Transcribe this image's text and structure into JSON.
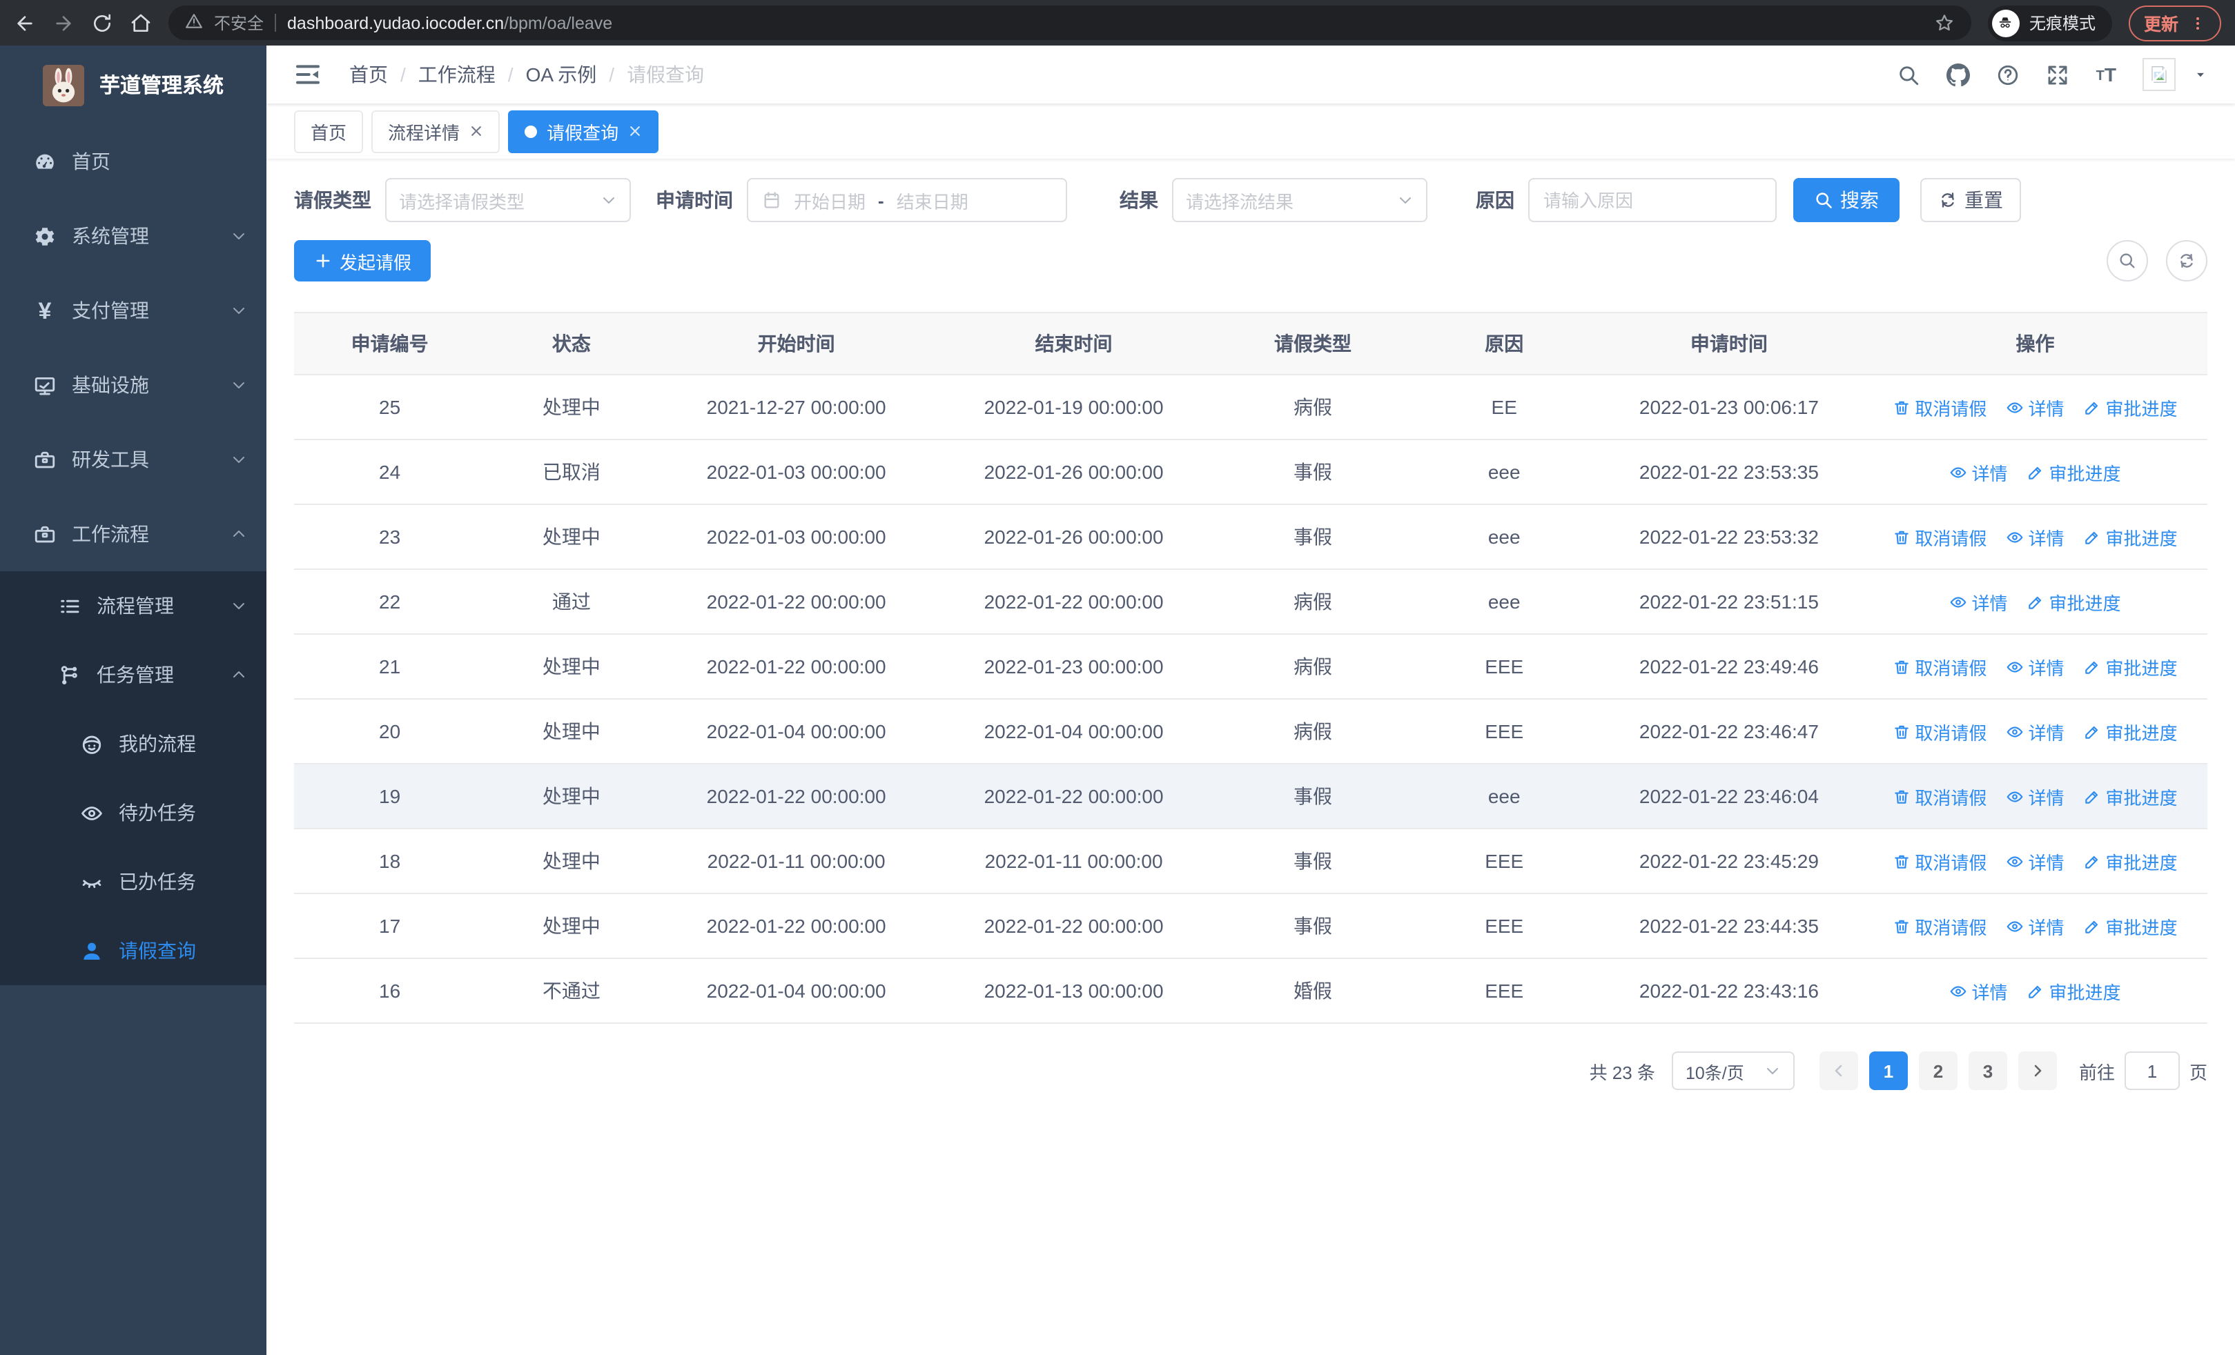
{
  "browser": {
    "security_label": "不安全",
    "url_host": "dashboard.yudao.iocoder.cn",
    "url_path": "/bpm/oa/leave",
    "incognito_label": "无痕模式",
    "update_label": "更新"
  },
  "sidebar": {
    "app_title": "芋道管理系统",
    "items": [
      {
        "name": "home",
        "label": "首页",
        "icon": "dashboard-icon",
        "level": 1,
        "submenu": false,
        "active": false,
        "chevron": null
      },
      {
        "name": "system-management",
        "label": "系统管理",
        "icon": "gear-icon",
        "level": 1,
        "submenu": false,
        "active": false,
        "chevron": "down"
      },
      {
        "name": "payment-management",
        "label": "支付管理",
        "icon": "yen-icon",
        "level": 1,
        "submenu": false,
        "active": false,
        "chevron": "down"
      },
      {
        "name": "infrastructure",
        "label": "基础设施",
        "icon": "monitor-icon",
        "level": 1,
        "submenu": false,
        "active": false,
        "chevron": "down"
      },
      {
        "name": "dev-tools",
        "label": "研发工具",
        "icon": "toolbox-icon",
        "level": 1,
        "submenu": false,
        "active": false,
        "chevron": "down"
      },
      {
        "name": "workflow",
        "label": "工作流程",
        "icon": "briefcase-icon",
        "level": 1,
        "submenu": false,
        "active": false,
        "chevron": "up"
      },
      {
        "name": "process-management",
        "label": "流程管理",
        "icon": "list-icon",
        "level": 2,
        "submenu": true,
        "active": false,
        "chevron": "down"
      },
      {
        "name": "task-management",
        "label": "任务管理",
        "icon": "flow-icon",
        "level": 2,
        "submenu": true,
        "active": false,
        "chevron": "up"
      },
      {
        "name": "my-process",
        "label": "我的流程",
        "icon": "robot-icon",
        "level": 3,
        "submenu": true,
        "active": false,
        "chevron": null
      },
      {
        "name": "todo-tasks",
        "label": "待办任务",
        "icon": "eye-icon",
        "level": 3,
        "submenu": true,
        "active": false,
        "chevron": null
      },
      {
        "name": "done-tasks",
        "label": "已办任务",
        "icon": "eye-closed-icon",
        "level": 3,
        "submenu": true,
        "active": false,
        "chevron": null
      },
      {
        "name": "leave-query",
        "label": "请假查询",
        "icon": "user-icon",
        "level": 3,
        "submenu": true,
        "active": true,
        "chevron": null
      }
    ]
  },
  "header": {
    "breadcrumb": [
      "首页",
      "工作流程",
      "OA 示例",
      "请假查询"
    ],
    "right_icons": [
      "search-icon",
      "github-icon",
      "help-icon",
      "fullscreen-icon",
      "fontsize-icon"
    ]
  },
  "tabs": [
    {
      "name": "home",
      "label": "首页",
      "closable": false,
      "active": false
    },
    {
      "name": "process-detail",
      "label": "流程详情",
      "closable": true,
      "active": false
    },
    {
      "name": "leave-query",
      "label": "请假查询",
      "closable": true,
      "active": true
    }
  ],
  "filters": {
    "type_label": "请假类型",
    "type_placeholder": "请选择请假类型",
    "time_label": "申请时间",
    "time_start_placeholder": "开始日期",
    "time_separator": "-",
    "time_end_placeholder": "结束日期",
    "result_label": "结果",
    "result_placeholder": "请选择流结果",
    "reason_label": "原因",
    "reason_placeholder": "请输入原因",
    "search_label": "搜索",
    "reset_label": "重置"
  },
  "toolbar": {
    "create_label": "发起请假"
  },
  "table": {
    "columns": [
      {
        "key": "id",
        "label": "申请编号",
        "width": "10%"
      },
      {
        "key": "status",
        "label": "状态",
        "width": "9%"
      },
      {
        "key": "start_time",
        "label": "开始时间",
        "width": "14.5%"
      },
      {
        "key": "end_time",
        "label": "结束时间",
        "width": "14.5%"
      },
      {
        "key": "leave_type",
        "label": "请假类型",
        "width": "10.5%"
      },
      {
        "key": "reason",
        "label": "原因",
        "width": "9.5%"
      },
      {
        "key": "apply_time",
        "label": "申请时间",
        "width": "14%"
      },
      {
        "key": "actions",
        "label": "操作",
        "width": "18%"
      }
    ],
    "action_labels": {
      "cancel": "取消请假",
      "detail": "详情",
      "progress": "审批进度"
    },
    "rows": [
      {
        "id": "25",
        "status": "处理中",
        "start_time": "2021-12-27 00:00:00",
        "end_time": "2022-01-19 00:00:00",
        "leave_type": "病假",
        "reason": "EE",
        "apply_time": "2022-01-23 00:06:17",
        "actions": [
          "cancel",
          "detail",
          "progress"
        ],
        "highlighted": false
      },
      {
        "id": "24",
        "status": "已取消",
        "start_time": "2022-01-03 00:00:00",
        "end_time": "2022-01-26 00:00:00",
        "leave_type": "事假",
        "reason": "eee",
        "apply_time": "2022-01-22 23:53:35",
        "actions": [
          "detail",
          "progress"
        ],
        "highlighted": false
      },
      {
        "id": "23",
        "status": "处理中",
        "start_time": "2022-01-03 00:00:00",
        "end_time": "2022-01-26 00:00:00",
        "leave_type": "事假",
        "reason": "eee",
        "apply_time": "2022-01-22 23:53:32",
        "actions": [
          "cancel",
          "detail",
          "progress"
        ],
        "highlighted": false
      },
      {
        "id": "22",
        "status": "通过",
        "start_time": "2022-01-22 00:00:00",
        "end_time": "2022-01-22 00:00:00",
        "leave_type": "病假",
        "reason": "eee",
        "apply_time": "2022-01-22 23:51:15",
        "actions": [
          "detail",
          "progress"
        ],
        "highlighted": false
      },
      {
        "id": "21",
        "status": "处理中",
        "start_time": "2022-01-22 00:00:00",
        "end_time": "2022-01-23 00:00:00",
        "leave_type": "病假",
        "reason": "EEE",
        "apply_time": "2022-01-22 23:49:46",
        "actions": [
          "cancel",
          "detail",
          "progress"
        ],
        "highlighted": false
      },
      {
        "id": "20",
        "status": "处理中",
        "start_time": "2022-01-04 00:00:00",
        "end_time": "2022-01-04 00:00:00",
        "leave_type": "病假",
        "reason": "EEE",
        "apply_time": "2022-01-22 23:46:47",
        "actions": [
          "cancel",
          "detail",
          "progress"
        ],
        "highlighted": false
      },
      {
        "id": "19",
        "status": "处理中",
        "start_time": "2022-01-22 00:00:00",
        "end_time": "2022-01-22 00:00:00",
        "leave_type": "事假",
        "reason": "eee",
        "apply_time": "2022-01-22 23:46:04",
        "actions": [
          "cancel",
          "detail",
          "progress"
        ],
        "highlighted": true
      },
      {
        "id": "18",
        "status": "处理中",
        "start_time": "2022-01-11 00:00:00",
        "end_time": "2022-01-11 00:00:00",
        "leave_type": "事假",
        "reason": "EEE",
        "apply_time": "2022-01-22 23:45:29",
        "actions": [
          "cancel",
          "detail",
          "progress"
        ],
        "highlighted": false
      },
      {
        "id": "17",
        "status": "处理中",
        "start_time": "2022-01-22 00:00:00",
        "end_time": "2022-01-22 00:00:00",
        "leave_type": "事假",
        "reason": "EEE",
        "apply_time": "2022-01-22 23:44:35",
        "actions": [
          "cancel",
          "detail",
          "progress"
        ],
        "highlighted": false
      },
      {
        "id": "16",
        "status": "不通过",
        "start_time": "2022-01-04 00:00:00",
        "end_time": "2022-01-13 00:00:00",
        "leave_type": "婚假",
        "reason": "EEE",
        "apply_time": "2022-01-22 23:43:16",
        "actions": [
          "detail",
          "progress"
        ],
        "highlighted": false
      }
    ]
  },
  "pagination": {
    "total_label": "共 23 条",
    "page_size_label": "10条/页",
    "pages": [
      "1",
      "2",
      "3"
    ],
    "active_page": "1",
    "goto_label": "前往",
    "goto_value": "1",
    "page_suffix": "页"
  },
  "colors": {
    "primary": "#2d8cf0",
    "sidebar_bg": "#304156",
    "sidebar_submenu_bg": "#212d3d",
    "table_header_bg": "#f8f8f9",
    "highlight_row_bg": "#f0f3f7",
    "update_accent": "#ee8277"
  }
}
